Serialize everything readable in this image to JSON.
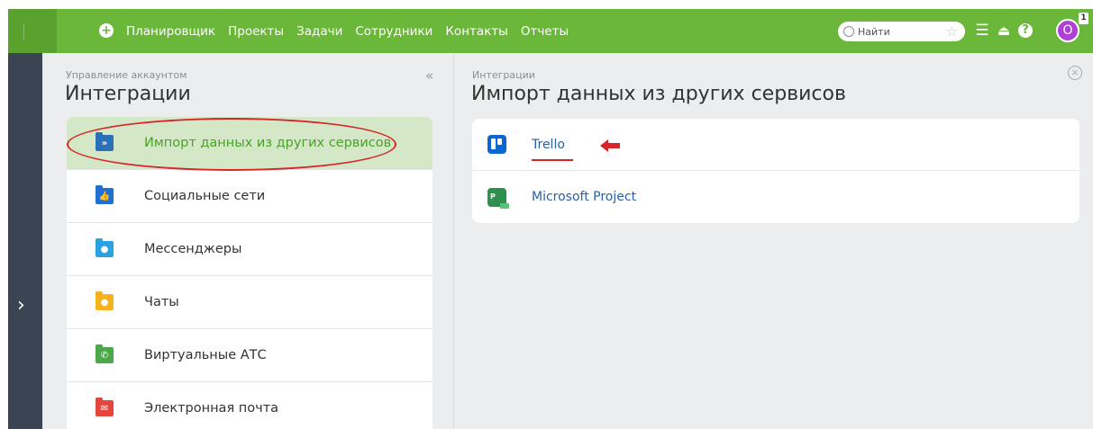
{
  "topbar": {
    "menu": [
      "Планировщик",
      "Проекты",
      "Задачи",
      "Сотрудники",
      "Контакты",
      "Отчеты"
    ],
    "search_placeholder": "Найти",
    "avatar_letter": "О",
    "badge_count": "1",
    "accent_color": "#6bb73a"
  },
  "left": {
    "breadcrumb": "Управление аккаунтом",
    "title": "Интеграции",
    "items": [
      {
        "label": "Импорт данных из других сервисов",
        "icon": "import-icon",
        "color": "#2b6fb8",
        "active": true
      },
      {
        "label": "Социальные сети",
        "icon": "thumbs-up-icon",
        "color": "#1e6fd6"
      },
      {
        "label": "Мессенджеры",
        "icon": "chat-bubble-icon",
        "color": "#29a3e0"
      },
      {
        "label": "Чаты",
        "icon": "chat-icon",
        "color": "#f5b21c"
      },
      {
        "label": "Виртуальные АТС",
        "icon": "phone-icon",
        "color": "#4aa84a"
      },
      {
        "label": "Электронная почта",
        "icon": "mail-icon",
        "color": "#e2463c"
      }
    ]
  },
  "right": {
    "breadcrumb": "Интеграции",
    "title": "Импорт данных из других сервисов",
    "services": [
      {
        "label": "Trello",
        "icon": "trello-icon"
      },
      {
        "label": "Microsoft Project",
        "icon": "microsoft-project-icon"
      }
    ]
  }
}
